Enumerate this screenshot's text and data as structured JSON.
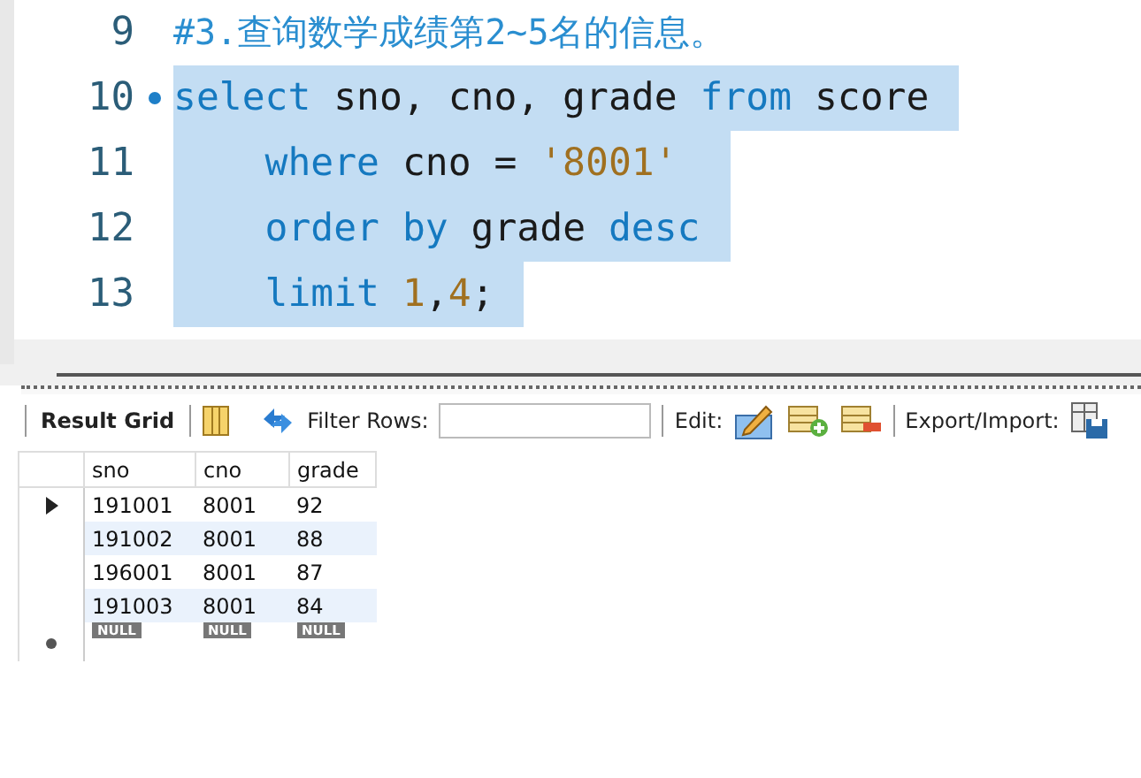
{
  "editor": {
    "lines": [
      {
        "number": "9",
        "marker": false,
        "selected": false,
        "tokens": [
          {
            "kind": "comment",
            "text": "#3.查询数学成绩第2~5名的信息。"
          }
        ]
      },
      {
        "number": "10",
        "marker": true,
        "selected": true,
        "tokens": [
          {
            "kind": "keyword",
            "text": "select"
          },
          {
            "kind": "plain",
            "text": " sno, cno, grade "
          },
          {
            "kind": "keyword",
            "text": "from"
          },
          {
            "kind": "plain",
            "text": " score "
          }
        ]
      },
      {
        "number": "11",
        "marker": false,
        "selected": true,
        "tokens": [
          {
            "kind": "keyword",
            "text": "    where"
          },
          {
            "kind": "plain",
            "text": " cno = "
          },
          {
            "kind": "literal",
            "text": "'8001'  "
          }
        ]
      },
      {
        "number": "12",
        "marker": false,
        "selected": true,
        "tokens": [
          {
            "kind": "keyword",
            "text": "    order by"
          },
          {
            "kind": "plain",
            "text": " grade "
          },
          {
            "kind": "keyword",
            "text": "desc "
          }
        ]
      },
      {
        "number": "13",
        "marker": false,
        "selected": true,
        "tokens": [
          {
            "kind": "keyword",
            "text": "    limit "
          },
          {
            "kind": "literal",
            "text": "1"
          },
          {
            "kind": "plain",
            "text": ","
          },
          {
            "kind": "literal",
            "text": "4"
          },
          {
            "kind": "plain",
            "text": "; "
          }
        ]
      }
    ]
  },
  "toolbar": {
    "result_tab": "Result Grid",
    "filter_label": "Filter Rows:",
    "edit_label": "Edit:",
    "export_label": "Export/Import:"
  },
  "grid": {
    "columns": [
      "sno",
      "cno",
      "grade"
    ],
    "rows": [
      {
        "selected": true,
        "cells": [
          "191001",
          "8001",
          "92"
        ]
      },
      {
        "selected": false,
        "cells": [
          "191002",
          "8001",
          "88"
        ]
      },
      {
        "selected": false,
        "cells": [
          "196001",
          "8001",
          "87"
        ]
      },
      {
        "selected": false,
        "cells": [
          "191003",
          "8001",
          "84"
        ]
      }
    ],
    "new_row": [
      "NULL",
      "NULL",
      "NULL"
    ]
  }
}
